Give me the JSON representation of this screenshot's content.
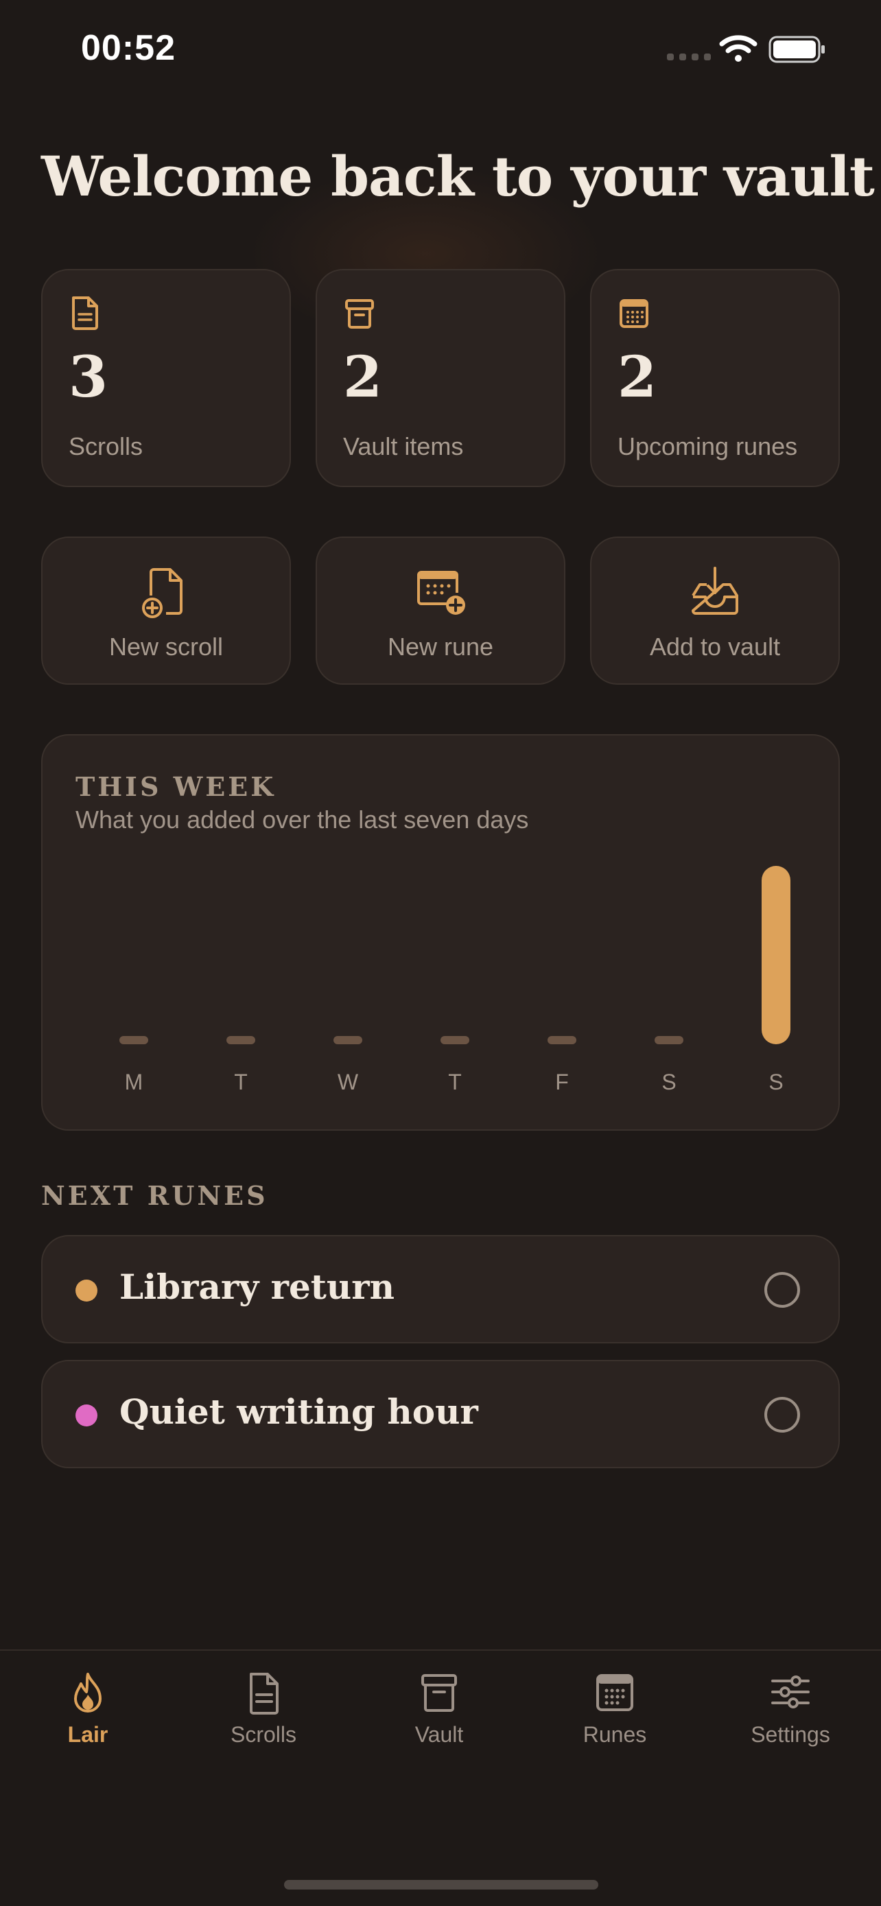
{
  "status_bar": {
    "time": "00:52"
  },
  "header": {
    "title": "Welcome back to your vault"
  },
  "stats": [
    {
      "value": "3",
      "label": "Scrolls",
      "icon": "document-icon"
    },
    {
      "value": "2",
      "label": "Vault items",
      "icon": "archive-box-icon"
    },
    {
      "value": "2",
      "label": "Upcoming runes",
      "icon": "calendar-icon"
    }
  ],
  "actions": [
    {
      "label": "New scroll",
      "icon": "document-plus-icon"
    },
    {
      "label": "New rune",
      "icon": "calendar-plus-icon"
    },
    {
      "label": "Add to vault",
      "icon": "inbox-download-icon"
    }
  ],
  "chart_data": {
    "type": "bar",
    "title": "THIS WEEK",
    "subtitle": "What you added over the last seven days",
    "categories": [
      "M",
      "T",
      "W",
      "T",
      "F",
      "S",
      "S"
    ],
    "values": [
      0,
      0,
      0,
      0,
      0,
      0,
      1
    ],
    "colors": {
      "empty": "#6b5444",
      "filled": "#dda25a"
    }
  },
  "next_runes": {
    "heading": "NEXT RUNES",
    "items": [
      {
        "title": "Library return",
        "color": "#dda25a"
      },
      {
        "title": "Quiet writing hour",
        "color": "#e06bc4"
      }
    ]
  },
  "tabs": [
    {
      "label": "Lair",
      "icon": "flame-icon",
      "active": true
    },
    {
      "label": "Scrolls",
      "icon": "document-icon",
      "active": false
    },
    {
      "label": "Vault",
      "icon": "archive-box-icon",
      "active": false
    },
    {
      "label": "Runes",
      "icon": "calendar-icon",
      "active": false
    },
    {
      "label": "Settings",
      "icon": "sliders-icon",
      "active": false
    }
  ],
  "colors": {
    "accent": "#dda25a",
    "background": "#1e1917",
    "card": "#2b2320"
  }
}
